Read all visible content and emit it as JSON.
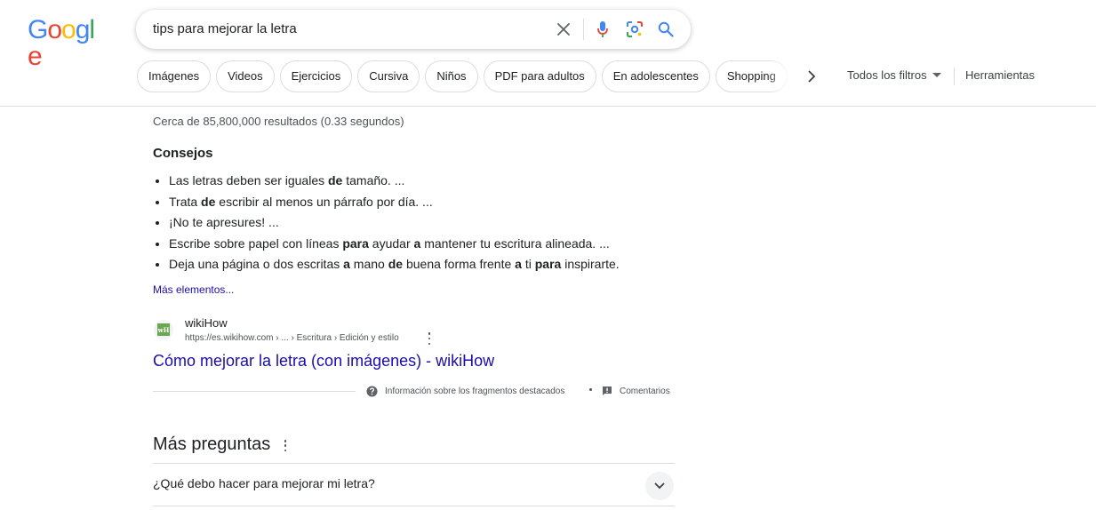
{
  "logo": {
    "letters": [
      "G",
      "o",
      "o",
      "g",
      "l",
      "e"
    ],
    "colors": [
      "#4285f4",
      "#ea4335",
      "#fbbc05",
      "#4285f4",
      "#34a853",
      "#ea4335"
    ]
  },
  "search": {
    "query": "tips para mejorar la letra",
    "icons": [
      "close-icon",
      "microphone-icon",
      "lens-icon",
      "search-icon"
    ]
  },
  "filters": {
    "chips": [
      "Imágenes",
      "Videos",
      "Ejercicios",
      "Cursiva",
      "Niños",
      "PDF para adultos",
      "En adolescentes",
      "Shopping"
    ],
    "all_filters": "Todos los filtros",
    "tools": "Herramientas"
  },
  "results": {
    "stats": "Cerca de 85,800,000 resultados (0.33 segundos)",
    "snippet_title": "Consejos",
    "tips": [
      [
        {
          "t": "Las letras deben ser iguales "
        },
        {
          "t": "de",
          "b": true
        },
        {
          "t": " tamaño. ..."
        }
      ],
      [
        {
          "t": "Trata "
        },
        {
          "t": "de",
          "b": true
        },
        {
          "t": " escribir al menos un párrafo por día. ..."
        }
      ],
      [
        {
          "t": "¡No te apresures! ..."
        }
      ],
      [
        {
          "t": "Escribe sobre papel con líneas "
        },
        {
          "t": "para",
          "b": true
        },
        {
          "t": " ayudar "
        },
        {
          "t": "a",
          "b": true
        },
        {
          "t": " mantener tu escritura alineada. ..."
        }
      ],
      [
        {
          "t": "Deja una página o dos escritas "
        },
        {
          "t": "a",
          "b": true
        },
        {
          "t": " mano "
        },
        {
          "t": "de",
          "b": true
        },
        {
          "t": " buena forma frente "
        },
        {
          "t": "a",
          "b": true
        },
        {
          "t": " ti "
        },
        {
          "t": "para",
          "b": true
        },
        {
          "t": " inspirarte."
        }
      ]
    ],
    "more_items": "Más elementos...",
    "source": {
      "favicon_text": "wH",
      "name": "wikiHow",
      "url": "https://es.wikihow.com › ... › Escritura › Edición y estilo",
      "title": "Cómo mejorar la letra (con imágenes) - wikiHow"
    },
    "feedback": {
      "info": "Información sobre los fragmentos destacados",
      "comments": "Comentarios"
    }
  },
  "paa": {
    "title": "Más preguntas",
    "questions": [
      "¿Qué debo hacer para mejorar mi letra?"
    ]
  }
}
